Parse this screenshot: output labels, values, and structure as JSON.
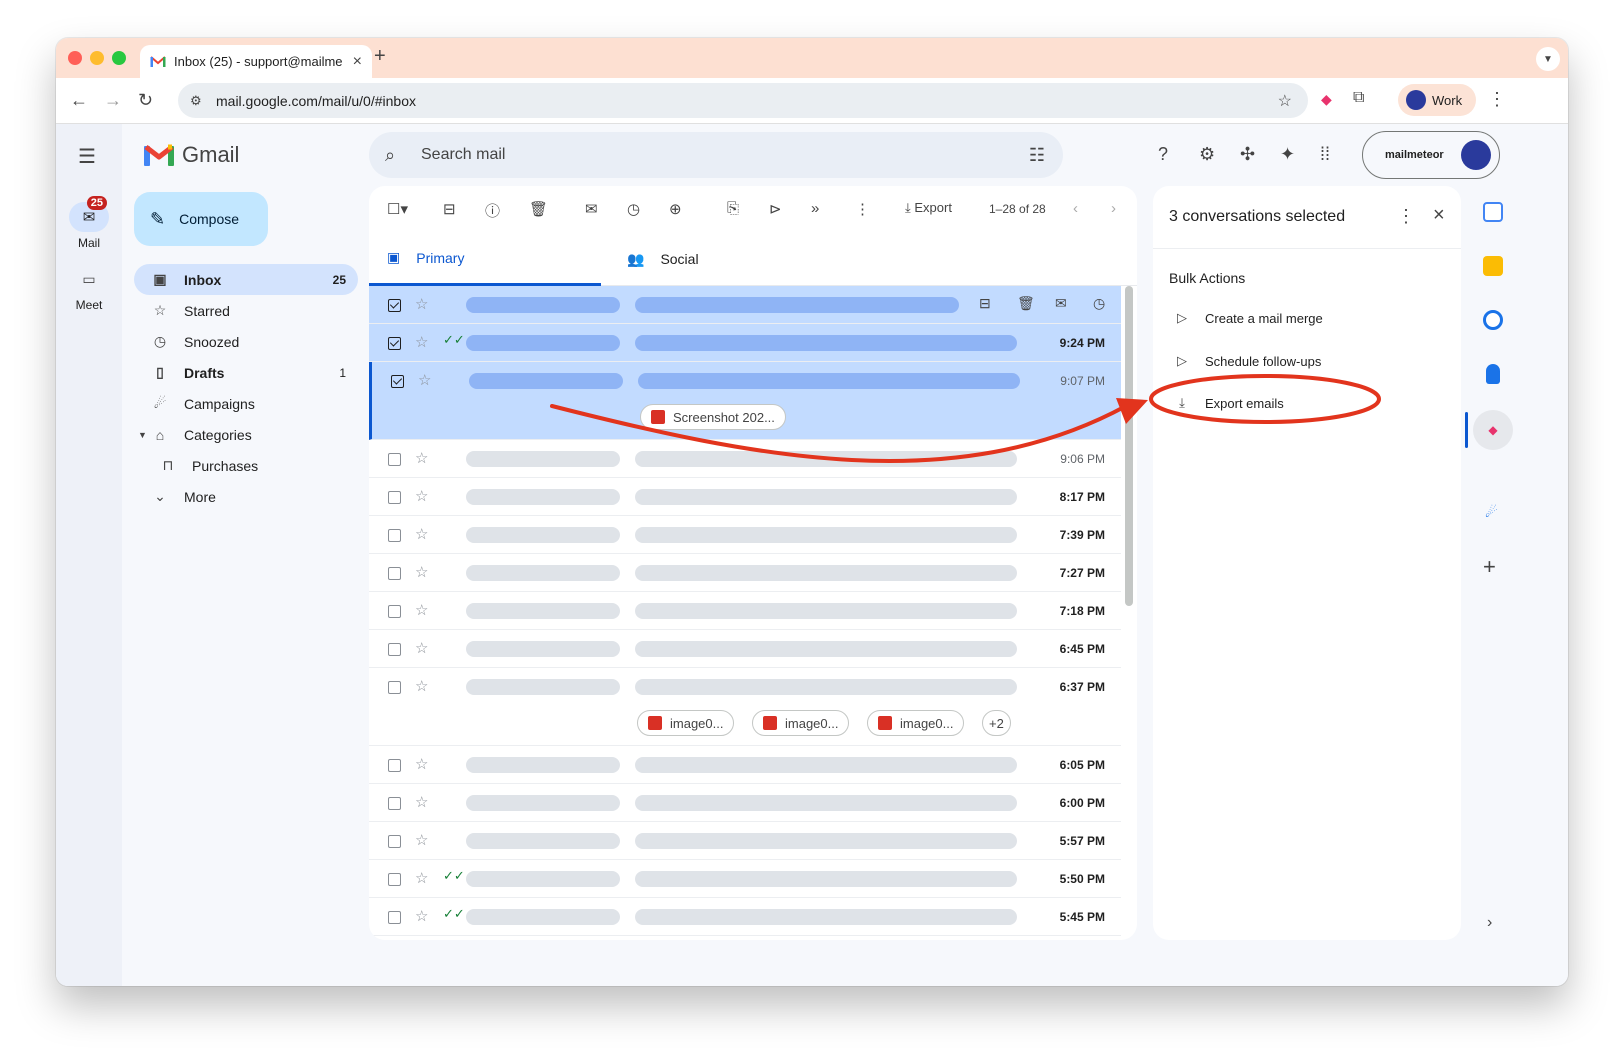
{
  "browser": {
    "tab_title": "Inbox (25) - support@mailme",
    "tab_close": "×",
    "new_tab": "+",
    "url": "mail.google.com/mail/u/0/#inbox",
    "profile_label": "Work"
  },
  "gmail": {
    "logo_text": "Gmail",
    "search_placeholder": "Search mail",
    "account_label": "mailmeteor",
    "compose_label": "Compose",
    "rail": [
      {
        "label": "Mail",
        "badge": "25"
      },
      {
        "label": "Meet"
      }
    ],
    "nav": [
      {
        "label": "Inbox",
        "count": "25",
        "icon": "inbox-icon"
      },
      {
        "label": "Starred",
        "count": "",
        "icon": "star-icon"
      },
      {
        "label": "Snoozed",
        "count": "",
        "icon": "clock-icon"
      },
      {
        "label": "Drafts",
        "count": "1",
        "icon": "draft-icon"
      },
      {
        "label": "Campaigns",
        "count": "",
        "icon": "meteor-icon"
      },
      {
        "label": "Categories",
        "count": "",
        "icon": "label-icon"
      },
      {
        "label": "Purchases",
        "count": "",
        "icon": "bag-icon"
      },
      {
        "label": "More",
        "count": "",
        "icon": "chevron-down-icon"
      }
    ],
    "toolbar": {
      "export_label": "Export",
      "pagination": "1–28 of 28"
    },
    "tabs": [
      {
        "label": "Primary"
      },
      {
        "label": "Social"
      }
    ],
    "rows": [
      {
        "time": ""
      },
      {
        "time": "9:24 PM"
      },
      {
        "time": "9:07 PM",
        "chips": [
          "Screenshot 202..."
        ]
      },
      {
        "time": "9:06 PM"
      },
      {
        "time": "8:17 PM"
      },
      {
        "time": "7:39 PM"
      },
      {
        "time": "7:27 PM"
      },
      {
        "time": "7:18 PM"
      },
      {
        "time": "6:45 PM"
      },
      {
        "time": "6:37 PM",
        "chips": [
          "image0...",
          "image0...",
          "image0..."
        ],
        "more": "+2"
      },
      {
        "time": "6:05 PM"
      },
      {
        "time": "6:00 PM"
      },
      {
        "time": "5:57 PM"
      },
      {
        "time": "5:50 PM"
      },
      {
        "time": "5:45 PM"
      }
    ],
    "side_panel": {
      "title": "3 conversations selected",
      "section": "Bulk Actions",
      "actions": [
        {
          "label": "Create a mail merge",
          "icon": "send-icon"
        },
        {
          "label": "Schedule follow-ups",
          "icon": "follow-up-icon"
        },
        {
          "label": "Export emails",
          "icon": "download-icon"
        }
      ]
    },
    "colors": {
      "accent": "#0b57d0",
      "selected_row": "#c2dbff",
      "annotation": "#e2341d"
    }
  }
}
